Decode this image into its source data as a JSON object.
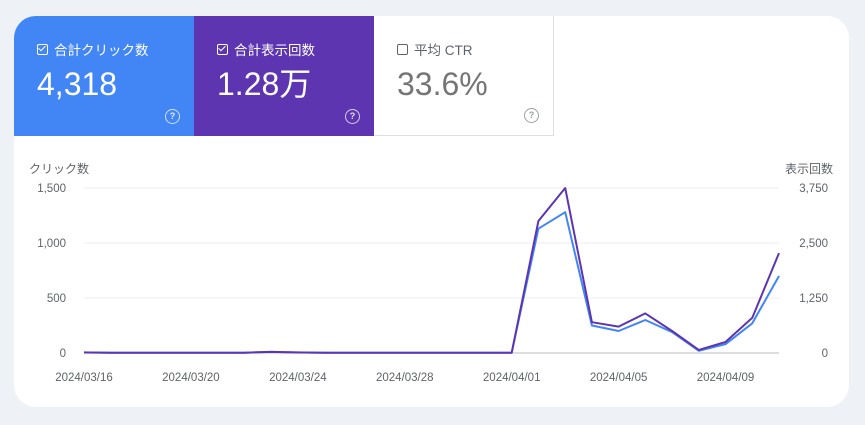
{
  "metrics": [
    {
      "label": "合計クリック数",
      "value": "4,318",
      "checked": true
    },
    {
      "label": "合計表示回数",
      "value": "1.28万",
      "checked": true
    },
    {
      "label": "平均 CTR",
      "value": "33.6%",
      "checked": false
    }
  ],
  "help_glyph": "?",
  "colors": {
    "clicks": "#4285f4",
    "impressions": "#5e35b1"
  },
  "chart_data": {
    "type": "line",
    "left_axis_title": "クリック数",
    "right_axis_title": "表示回数",
    "left_ylim": [
      0,
      1500
    ],
    "right_ylim": [
      0,
      3750
    ],
    "left_ticks": [
      "1,500",
      "1,000",
      "500",
      "0"
    ],
    "right_ticks": [
      "3,750",
      "2,500",
      "1,250",
      "0"
    ],
    "x_tick_labels": [
      "2024/03/16",
      "2024/03/20",
      "2024/03/24",
      "2024/03/28",
      "2024/04/01",
      "2024/04/05",
      "2024/04/09"
    ],
    "x": [
      "2024/03/16",
      "2024/03/17",
      "2024/03/18",
      "2024/03/19",
      "2024/03/20",
      "2024/03/21",
      "2024/03/22",
      "2024/03/23",
      "2024/03/24",
      "2024/03/25",
      "2024/03/26",
      "2024/03/27",
      "2024/03/28",
      "2024/03/29",
      "2024/03/30",
      "2024/03/31",
      "2024/04/01",
      "2024/04/02",
      "2024/04/03",
      "2024/04/04",
      "2024/04/05",
      "2024/04/06",
      "2024/04/07",
      "2024/04/08",
      "2024/04/09",
      "2024/04/10",
      "2024/04/11"
    ],
    "series": [
      {
        "name": "クリック数",
        "axis": "left",
        "color": "#4285f4",
        "values": [
          5,
          2,
          2,
          2,
          2,
          2,
          3,
          10,
          5,
          3,
          3,
          3,
          3,
          3,
          3,
          3,
          3,
          1130,
          1280,
          250,
          200,
          300,
          190,
          20,
          80,
          270,
          700
        ]
      },
      {
        "name": "表示回数",
        "axis": "right",
        "color": "#5e35b1",
        "values": [
          12,
          5,
          5,
          5,
          5,
          5,
          7,
          25,
          12,
          7,
          7,
          7,
          7,
          7,
          7,
          7,
          7,
          3000,
          3750,
          700,
          600,
          900,
          500,
          70,
          250,
          800,
          2270
        ]
      }
    ],
    "grid": true
  }
}
